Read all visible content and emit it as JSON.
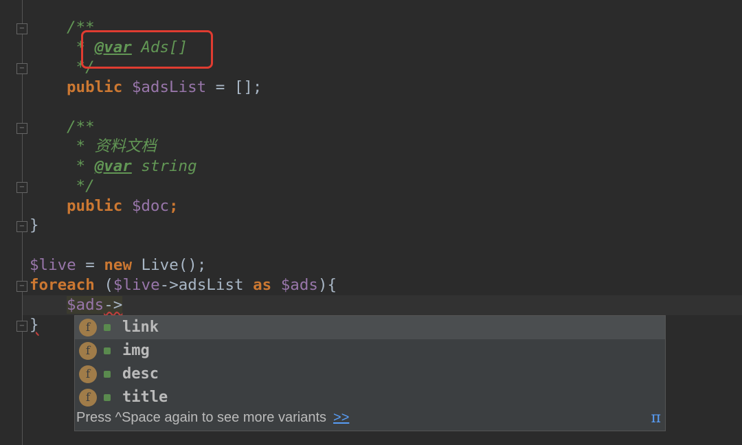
{
  "code": {
    "l1": "/**",
    "l2_star": " * ",
    "l2_tag": "@var",
    "l2_type": " Ads[]",
    "l3": " */",
    "l4_kw": "public",
    "l4_var": "$adsList",
    "l4_rest": " = [];",
    "l6": "/**",
    "l7": " * 资料文档",
    "l8_star": " * ",
    "l8_tag": "@var",
    "l8_type": " string",
    "l9": " */",
    "l10_kw": "public",
    "l10_var": "$doc",
    "l10_rest": ";",
    "l11": "}",
    "l13_var": "$live",
    "l13_op": " = ",
    "l13_kw": "new",
    "l13_rest": " Live();",
    "l14_kw": "foreach",
    "l14_a": " (",
    "l14_v1": "$live",
    "l14_b": "->adsList ",
    "l14_kw2": "as",
    "l14_c": " ",
    "l14_v2": "$ads",
    "l14_d": "){",
    "l15_var": "$ads",
    "l15_rest": "->",
    "l16": "}"
  },
  "completion": {
    "items": [
      {
        "label": "link",
        "icon": "field-icon"
      },
      {
        "label": "img",
        "icon": "field-icon"
      },
      {
        "label": "desc",
        "icon": "field-icon"
      },
      {
        "label": "title",
        "icon": "field-icon"
      }
    ],
    "selected": "link",
    "field_letter": "f",
    "footer": "Press ^Space again to see more variants",
    "more_link": ">>",
    "pi": "π"
  },
  "colors": {
    "highlight_box": "#e03c31",
    "keyword": "#cc7832",
    "variable": "#9876aa",
    "comment": "#629755"
  }
}
